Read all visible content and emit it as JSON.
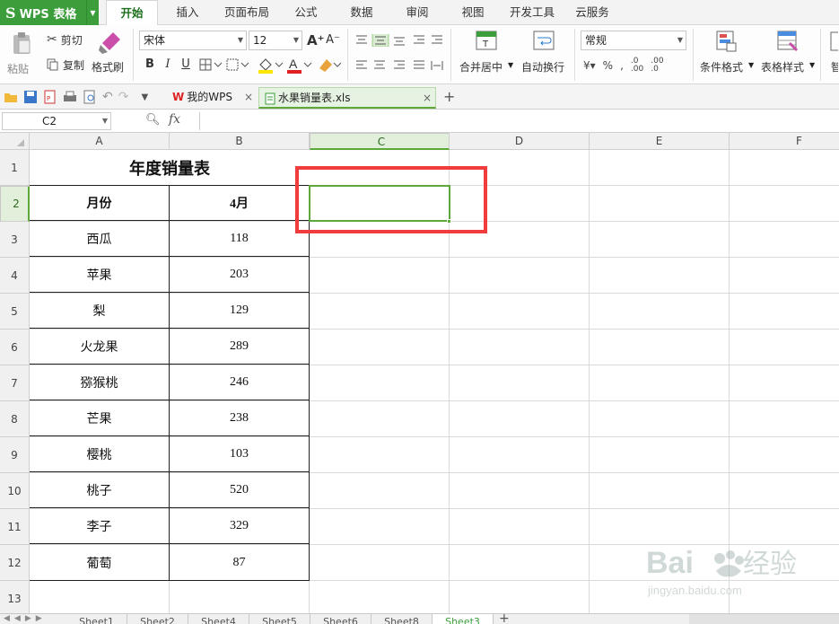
{
  "app": {
    "brand": "WPS 表格",
    "brand_color": "#3b9e3b",
    "accent": "#5da83b"
  },
  "menu": {
    "tabs": [
      "开始",
      "插入",
      "页面布局",
      "公式",
      "数据",
      "审阅",
      "视图",
      "开发工具",
      "云服务"
    ],
    "active": "开始"
  },
  "ribbon": {
    "paste": "粘贴",
    "cut": "剪切",
    "copy": "复制",
    "format_painter": "格式刷",
    "font_name": "宋体",
    "font_size": "12",
    "merge_center": "合并居中",
    "wrap_text": "自动换行",
    "number_format": "常规",
    "conditional_format": "条件格式",
    "table_style": "表格样式",
    "more": "智"
  },
  "file_tabs": [
    {
      "label": "我的WPS",
      "icon": "wps-logo-icon"
    },
    {
      "label": "水果销量表.xls",
      "icon": "spreadsheet-file-icon"
    }
  ],
  "formula_bar": {
    "cell_ref": "C2",
    "fx": "fx",
    "content": ""
  },
  "columns": [
    "A",
    "B",
    "C",
    "D",
    "E",
    "F"
  ],
  "rows": [
    "1",
    "2",
    "3",
    "4",
    "5",
    "6",
    "7",
    "8",
    "9",
    "10",
    "11",
    "12",
    "13"
  ],
  "selected_cell": "C2",
  "sheet": {
    "title": "年度销量表",
    "headers": [
      "月份",
      "4月"
    ],
    "data": [
      [
        "西瓜",
        "118"
      ],
      [
        "苹果",
        "203"
      ],
      [
        "梨",
        "129"
      ],
      [
        "火龙果",
        "289"
      ],
      [
        "猕猴桃",
        "246"
      ],
      [
        "芒果",
        "238"
      ],
      [
        "樱桃",
        "103"
      ],
      [
        "桃子",
        "520"
      ],
      [
        "李子",
        "329"
      ],
      [
        "葡萄",
        "87"
      ]
    ]
  },
  "sheet_tabs": [
    "Sheet1",
    "Sheet2",
    "Sheet4",
    "Sheet5",
    "Sheet6",
    "Sheet8",
    "Sheet3"
  ],
  "active_sheet": "Sheet3",
  "highlight_color": "#f03c3c",
  "watermark": {
    "brand": "Baidu经验",
    "url": "jingyan.baidu.com"
  }
}
